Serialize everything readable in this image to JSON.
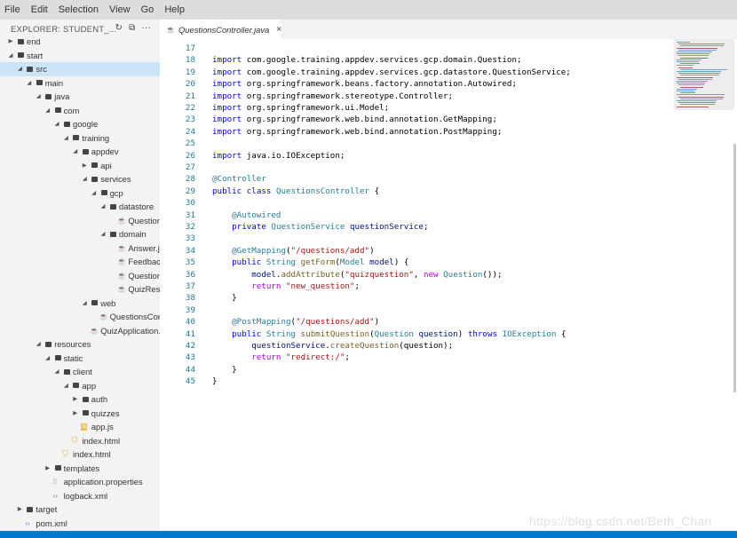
{
  "menu": [
    "File",
    "Edit",
    "Selection",
    "View",
    "Go",
    "Help"
  ],
  "explorer": {
    "title": "EXPLORER: STUDENT_...",
    "tree": [
      {
        "label": "end",
        "depth": 0,
        "kind": "folder",
        "state": "closed"
      },
      {
        "label": "start",
        "depth": 0,
        "kind": "folder",
        "state": "open"
      },
      {
        "label": "src",
        "depth": 1,
        "kind": "folder",
        "state": "open",
        "selected": true
      },
      {
        "label": "main",
        "depth": 2,
        "kind": "folder",
        "state": "open"
      },
      {
        "label": "java",
        "depth": 3,
        "kind": "folder",
        "state": "open"
      },
      {
        "label": "com",
        "depth": 4,
        "kind": "folder",
        "state": "open"
      },
      {
        "label": "google",
        "depth": 5,
        "kind": "folder",
        "state": "open"
      },
      {
        "label": "training",
        "depth": 6,
        "kind": "folder",
        "state": "open"
      },
      {
        "label": "appdev",
        "depth": 7,
        "kind": "folder",
        "state": "open"
      },
      {
        "label": "api",
        "depth": 8,
        "kind": "folder",
        "state": "closed"
      },
      {
        "label": "services",
        "depth": 8,
        "kind": "folder",
        "state": "open"
      },
      {
        "label": "gcp",
        "depth": 9,
        "kind": "folder",
        "state": "open"
      },
      {
        "label": "datastore",
        "depth": 10,
        "kind": "folder",
        "state": "open"
      },
      {
        "label": "QuestionService.j...",
        "depth": 11,
        "kind": "java"
      },
      {
        "label": "domain",
        "depth": 10,
        "kind": "folder",
        "state": "open"
      },
      {
        "label": "Answer.java",
        "depth": 11,
        "kind": "java"
      },
      {
        "label": "Feedback.java",
        "depth": 11,
        "kind": "java"
      },
      {
        "label": "Question.java",
        "depth": 11,
        "kind": "java"
      },
      {
        "label": "QuizResult.java",
        "depth": 11,
        "kind": "java"
      },
      {
        "label": "web",
        "depth": 8,
        "kind": "folder",
        "state": "open"
      },
      {
        "label": "QuestionsController.j...",
        "depth": 9,
        "kind": "java"
      },
      {
        "label": "QuizApplication.java",
        "depth": 8,
        "kind": "java"
      },
      {
        "label": "resources",
        "depth": 3,
        "kind": "folder",
        "state": "open"
      },
      {
        "label": "static",
        "depth": 4,
        "kind": "folder",
        "state": "open"
      },
      {
        "label": "client",
        "depth": 5,
        "kind": "folder",
        "state": "open"
      },
      {
        "label": "app",
        "depth": 6,
        "kind": "folder",
        "state": "open"
      },
      {
        "label": "auth",
        "depth": 7,
        "kind": "folder",
        "state": "closed"
      },
      {
        "label": "quizzes",
        "depth": 7,
        "kind": "folder",
        "state": "closed"
      },
      {
        "label": "app.js",
        "depth": 7,
        "kind": "js"
      },
      {
        "label": "index.html",
        "depth": 6,
        "kind": "html"
      },
      {
        "label": "index.html",
        "depth": 5,
        "kind": "html"
      },
      {
        "label": "templates",
        "depth": 4,
        "kind": "folder",
        "state": "closed"
      },
      {
        "label": "application.properties",
        "depth": 4,
        "kind": "properties"
      },
      {
        "label": "logback.xml",
        "depth": 4,
        "kind": "xml"
      },
      {
        "label": "target",
        "depth": 1,
        "kind": "folder",
        "state": "closed"
      },
      {
        "label": "pom.xml",
        "depth": 1,
        "kind": "xml"
      }
    ]
  },
  "tab": {
    "label": "QuestionsController.java",
    "close": "×"
  },
  "code": [
    {
      "n": "17",
      "tokens": []
    },
    {
      "n": "18",
      "tokens": [
        [
          "kw",
          "import"
        ],
        [
          "",
          "com.google.training.appdev.services.gcp.domain.Question;"
        ]
      ]
    },
    {
      "n": "19",
      "tokens": [
        [
          "kw",
          "import"
        ],
        [
          "",
          "com.google.training.appdev.services.gcp.datastore.QuestionService;"
        ]
      ]
    },
    {
      "n": "20",
      "tokens": [
        [
          "kw",
          "import"
        ],
        [
          "",
          "org.springframework.beans.factory.annotation.Autowired;"
        ]
      ]
    },
    {
      "n": "21",
      "tokens": [
        [
          "kw",
          "import"
        ],
        [
          "",
          "org.springframework.stereotype.Controller;"
        ]
      ]
    },
    {
      "n": "22",
      "tokens": [
        [
          "kw",
          "import"
        ],
        [
          "",
          "org.springframework.ui.Model;"
        ]
      ]
    },
    {
      "n": "23",
      "tokens": [
        [
          "kw",
          "import"
        ],
        [
          "",
          "org.springframework.web.bind.annotation.GetMapping;"
        ]
      ]
    },
    {
      "n": "24",
      "tokens": [
        [
          "kw",
          "import"
        ],
        [
          "",
          "org.springframework.web.bind.annotation.PostMapping;"
        ]
      ]
    },
    {
      "n": "25",
      "tokens": []
    },
    {
      "n": "26",
      "tokens": [
        [
          "kw",
          "import"
        ],
        [
          "",
          "java.io.IOException;"
        ]
      ]
    },
    {
      "n": "27",
      "tokens": []
    },
    {
      "n": "28",
      "tokens": [
        [
          "ann",
          "@Controller"
        ]
      ]
    },
    {
      "n": "29",
      "tokens": [
        [
          "kw",
          "public"
        ],
        [
          "kw",
          "class"
        ],
        [
          "ty",
          "QuestionsController"
        ],
        [
          "",
          "{"
        ]
      ]
    },
    {
      "n": "30",
      "tokens": []
    },
    {
      "n": "31",
      "indent": 4,
      "tokens": [
        [
          "ann",
          "@Autowired"
        ]
      ]
    },
    {
      "n": "32",
      "indent": 4,
      "tokens": [
        [
          "kw",
          "private"
        ],
        [
          "ty",
          "QuestionService"
        ],
        [
          "var",
          "questionService"
        ],
        [
          "",
          "",
          "nosp"
        ],
        [
          ";",
          "",
          "nosp"
        ]
      ]
    },
    {
      "n": "33",
      "tokens": []
    },
    {
      "n": "34",
      "indent": 4,
      "tokens": [
        [
          "ann",
          "@GetMapping"
        ],
        [
          "",
          "(",
          "nosp"
        ],
        [
          "str",
          "\"/questions/add\"",
          "nosp"
        ],
        [
          "",
          ")",
          "nosp"
        ]
      ]
    },
    {
      "n": "35",
      "indent": 4,
      "tokens": [
        [
          "kw",
          "public"
        ],
        [
          "ty",
          "String"
        ],
        [
          "fn",
          "getForm"
        ],
        [
          "",
          "(",
          "nosp"
        ],
        [
          "ty",
          "Model",
          "nosp"
        ],
        [
          "var",
          "model"
        ],
        [
          "",
          ")",
          "nosp"
        ],
        [
          "",
          "{"
        ]
      ]
    },
    {
      "n": "36",
      "indent": 8,
      "tokens": [
        [
          "var",
          "model"
        ],
        [
          "",
          ".",
          "nosp"
        ],
        [
          "fn",
          "addAttribute",
          "nosp"
        ],
        [
          "",
          "(",
          "nosp"
        ],
        [
          "str",
          "\"quizquestion\"",
          "nosp"
        ],
        [
          "",
          ",",
          "nosp"
        ],
        [
          "kw2",
          "new"
        ],
        [
          "ty",
          "Question"
        ],
        [
          "",
          "());",
          "nosp"
        ]
      ]
    },
    {
      "n": "37",
      "indent": 8,
      "tokens": [
        [
          "kw2",
          "return"
        ],
        [
          "str",
          "\"new_question\""
        ],
        [
          "",
          ";",
          "nosp"
        ]
      ]
    },
    {
      "n": "38",
      "indent": 4,
      "tokens": [
        [
          "",
          "}"
        ]
      ]
    },
    {
      "n": "39",
      "tokens": []
    },
    {
      "n": "40",
      "indent": 4,
      "tokens": [
        [
          "ann",
          "@PostMapping"
        ],
        [
          "",
          "(",
          "nosp"
        ],
        [
          "str",
          "\"/questions/add\"",
          "nosp"
        ],
        [
          "",
          ")",
          "nosp"
        ]
      ]
    },
    {
      "n": "41",
      "indent": 4,
      "tokens": [
        [
          "kw",
          "public"
        ],
        [
          "ty",
          "String"
        ],
        [
          "fn",
          "submitQuestion"
        ],
        [
          "",
          "(",
          "nosp"
        ],
        [
          "ty",
          "Question",
          "nosp"
        ],
        [
          "var",
          "question"
        ],
        [
          "",
          ")",
          "nosp"
        ],
        [
          "kw",
          "throws"
        ],
        [
          "ty",
          "IOException"
        ],
        [
          "",
          "{"
        ]
      ]
    },
    {
      "n": "42",
      "indent": 8,
      "tokens": [
        [
          "var",
          "questionService"
        ],
        [
          "",
          ".",
          "nosp"
        ],
        [
          "fn",
          "createQuestion",
          "nosp"
        ],
        [
          "",
          "(question);",
          "nosp"
        ]
      ]
    },
    {
      "n": "43",
      "indent": 8,
      "tokens": [
        [
          "kw2",
          "return"
        ],
        [
          "str",
          "\"redirect:/\""
        ],
        [
          "",
          ";",
          "nosp"
        ]
      ]
    },
    {
      "n": "44",
      "indent": 4,
      "tokens": [
        [
          "",
          "}"
        ]
      ]
    },
    {
      "n": "45",
      "tokens": [
        [
          "",
          "}"
        ]
      ]
    }
  ],
  "watermark": "https://blog.csdn.net/Beth_Chan",
  "colors": {
    "menubar": "#dddddd",
    "sidebar": "#f3f3f3",
    "selected_row": "#cce4f7",
    "status_bar": "#007acc",
    "line_numbers": "#237893",
    "keyword": "#0000ff",
    "control_keyword": "#af00db",
    "type": "#267f99",
    "string": "#a31515"
  },
  "icons": {
    "refresh": "refresh-icon",
    "collapse": "collapse-all-icon",
    "more": "more-icon",
    "java": "java-file-icon",
    "folder": "folder-icon"
  }
}
